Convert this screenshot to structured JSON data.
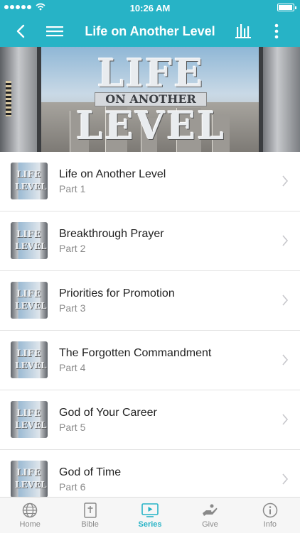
{
  "status_bar": {
    "time": "10:26 AM"
  },
  "nav": {
    "title": "Life on Another Level",
    "back_icon": "chevron-left-icon",
    "menu_icon": "hamburger-icon",
    "audio_icon": "audio-bars-icon",
    "more_icon": "more-vertical-icon"
  },
  "hero": {
    "line1": "LIFE",
    "line2": "ON ANOTHER",
    "line3": "LEVEL"
  },
  "thumbnail": {
    "line1": "LIFE",
    "line2": "LEVEL"
  },
  "episodes": [
    {
      "title": "Life on Another Level",
      "part": "Part 1"
    },
    {
      "title": "Breakthrough Prayer",
      "part": "Part 2"
    },
    {
      "title": "Priorities for Promotion",
      "part": "Part 3"
    },
    {
      "title": "The Forgotten Commandment",
      "part": "Part 4"
    },
    {
      "title": "God of Your Career",
      "part": "Part 5"
    },
    {
      "title": "God of Time",
      "part": "Part 6"
    }
  ],
  "tabs": [
    {
      "label": "Home",
      "icon": "globe-icon"
    },
    {
      "label": "Bible",
      "icon": "bible-icon"
    },
    {
      "label": "Series",
      "icon": "play-tv-icon",
      "active": true
    },
    {
      "label": "Give",
      "icon": "give-hand-icon"
    },
    {
      "label": "Info",
      "icon": "info-icon"
    }
  ],
  "colors": {
    "accent": "#27b3c6",
    "tab_inactive": "#8a8a8a"
  }
}
